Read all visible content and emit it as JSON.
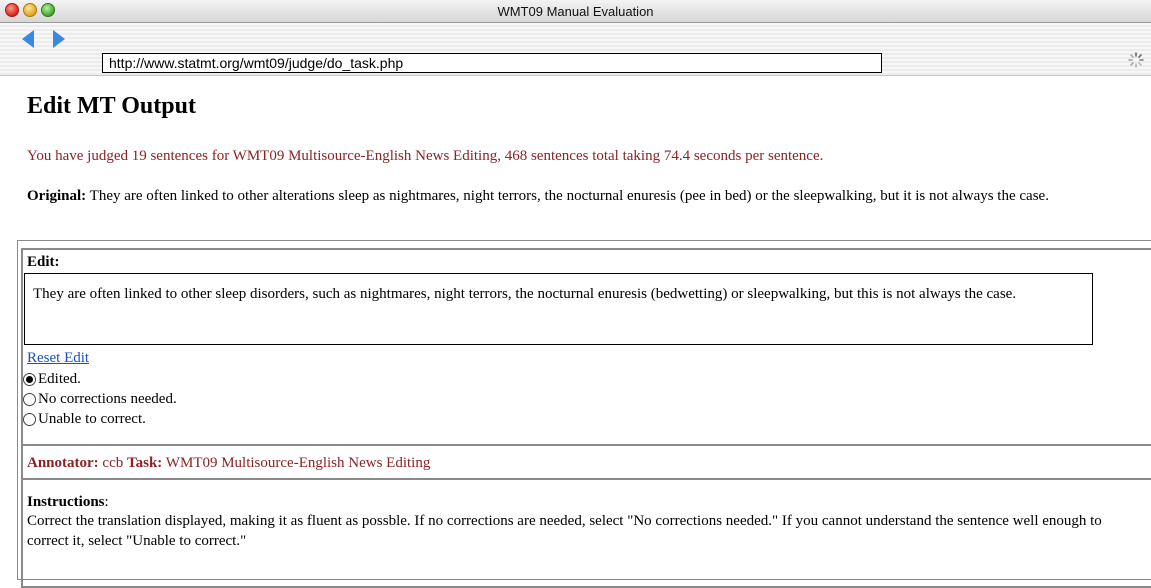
{
  "window": {
    "title": "WMT09 Manual Evaluation"
  },
  "toolbar": {
    "url": "http://www.statmt.org/wmt09/judge/do_task.php",
    "back_icon": "back-arrow-icon",
    "forward_icon": "forward-arrow-icon",
    "spinner_icon": "loading-spinner-icon",
    "accent": "#3b88e0"
  },
  "page": {
    "title": "Edit MT Output",
    "status": "You have judged 19 sentences for WMT09 Multisource-English News Editing, 468 sentences total taking 74.4 seconds per sentence.",
    "status_color": "#8b2323",
    "original_label": "Original:",
    "original_text": "They are often linked to other alterations sleep as nightmares, night terrors, the nocturnal enuresis (pee in bed) or the sleepwalking, but it is not always the case."
  },
  "edit": {
    "label": "Edit:",
    "text": "They are often linked to other sleep disorders, such as nightmares, night terrors, the nocturnal enuresis (bedwetting) or sleepwalking, but this is not always the case.",
    "reset_label": "Reset Edit",
    "options": [
      {
        "label": "Edited.",
        "checked": true
      },
      {
        "label": "No corrections needed.",
        "checked": false
      },
      {
        "label": "Unable to correct.",
        "checked": false
      }
    ]
  },
  "annotation": {
    "annotator_label": "Annotator:",
    "annotator": "ccb",
    "task_label": "Task:",
    "task": "WMT09 Multisource-English News Editing"
  },
  "instructions": {
    "label": "Instructions",
    "text": "Correct the translation displayed, making it as fluent as possble. If no corrections are needed, select \"No corrections needed.\" If you cannot understand the sentence well enough to correct it, select \"Unable to correct.\""
  }
}
